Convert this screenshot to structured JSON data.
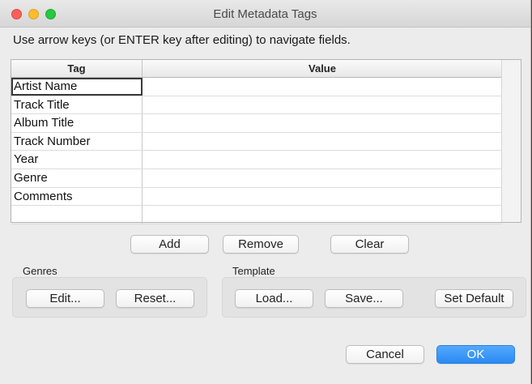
{
  "window": {
    "title": "Edit Metadata Tags"
  },
  "instructions": "Use arrow keys (or ENTER key after editing) to navigate fields.",
  "table": {
    "headers": {
      "tag": "Tag",
      "value": "Value"
    },
    "rows": [
      {
        "tag": "Artist Name",
        "value": ""
      },
      {
        "tag": "Track Title",
        "value": ""
      },
      {
        "tag": "Album Title",
        "value": ""
      },
      {
        "tag": "Track Number",
        "value": ""
      },
      {
        "tag": "Year",
        "value": ""
      },
      {
        "tag": "Genre",
        "value": ""
      },
      {
        "tag": "Comments",
        "value": ""
      },
      {
        "tag": "",
        "value": ""
      }
    ]
  },
  "actions": {
    "add": "Add",
    "remove": "Remove",
    "clear": "Clear"
  },
  "genres": {
    "label": "Genres",
    "edit": "Edit...",
    "reset": "Reset..."
  },
  "template": {
    "label": "Template",
    "load": "Load...",
    "save": "Save...",
    "set_default": "Set Default"
  },
  "footer": {
    "cancel": "Cancel",
    "ok": "OK"
  },
  "colors": {
    "accent": "#2a8bf2",
    "close": "#fc5f57",
    "minimize": "#fdbc2e",
    "maximize": "#28c840"
  }
}
